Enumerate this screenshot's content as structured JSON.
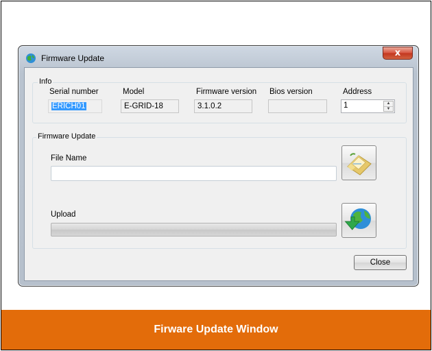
{
  "window": {
    "title": "Firmware Update",
    "close_glyph": "x"
  },
  "info": {
    "group_title": "Info",
    "serial_label": "Serial number",
    "serial_value": "ERICH01",
    "model_label": "Model",
    "model_value": "E-GRID-18",
    "fw_label": "Firmware version",
    "fw_value": "3.1.0.2",
    "bios_label": "Bios version",
    "bios_value": "",
    "address_label": "Address",
    "address_value": "1"
  },
  "firmware": {
    "group_title": "Firmware Update",
    "file_label": "File Name",
    "file_value": "",
    "upload_label": "Upload",
    "upload_progress": 0
  },
  "buttons": {
    "close_label": "Close",
    "browse_icon": "folder-envelope-icon",
    "upload_icon": "globe-download-icon"
  },
  "caption": "Firware Update Window"
}
